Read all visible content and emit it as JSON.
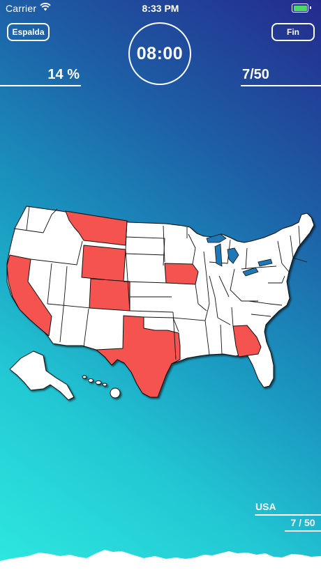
{
  "status_bar": {
    "carrier": "Carrier",
    "time": "8:33 PM"
  },
  "header": {
    "back_label": "Espalda",
    "finish_label": "Fin",
    "timer": "08:00",
    "progress_percent": "14 %",
    "score": "7/50"
  },
  "map": {
    "highlighted_states": [
      "California",
      "Montana",
      "Wyoming",
      "Colorado",
      "Texas",
      "Iowa",
      "Georgia"
    ],
    "highlight_color": "#f5524f",
    "state_fill": "#ffffff",
    "border_color": "#111111"
  },
  "footer": {
    "region": "USA",
    "count": "7 / 50"
  },
  "colors": {
    "gradient_top": "#242a8c",
    "gradient_bottom": "#2ee8df",
    "text": "#ffffff"
  }
}
